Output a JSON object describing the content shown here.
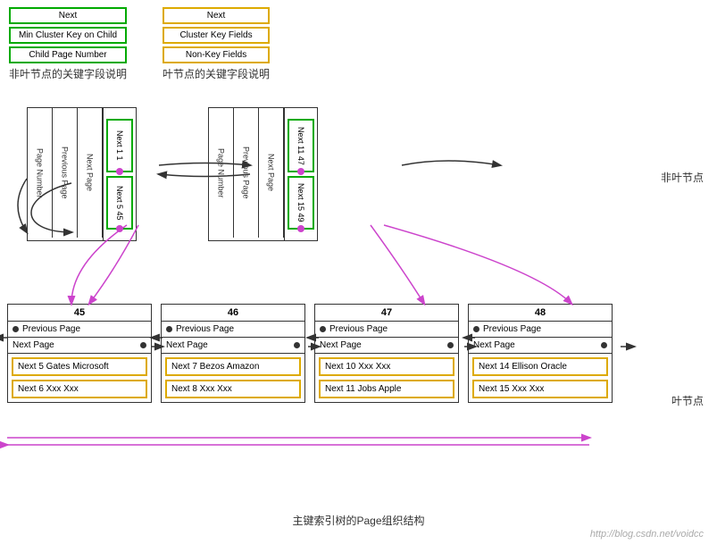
{
  "legend": {
    "nonleaf": {
      "title": "非叶节点的关键字段说明",
      "items": [
        "Next",
        "Min Cluster Key on Child",
        "Child Page Number"
      ],
      "border": "green"
    },
    "leaf": {
      "title": "叶节点的关键字段说明",
      "items": [
        "Next",
        "Cluster Key Fields",
        "Non-Key Fields"
      ],
      "border": "yellow"
    }
  },
  "nonleaf_label": "非叶节点",
  "leaf_label": "叶节点",
  "nonleaf_nodes": [
    {
      "cols": [
        "Page Number",
        "Previous Page",
        "Next Page",
        "Next 1 1",
        "Next 5 45"
      ]
    },
    {
      "cols": [
        "Page Number",
        "Previous Page",
        "Next Page",
        "Next 11 47",
        "Next 15 49"
      ]
    }
  ],
  "leaf_nodes": [
    {
      "number": "45",
      "prev": "Previous Page",
      "next": "Next Page",
      "rows": [
        "Next 5 Gates Microsoft",
        "Next 6 Xxx Xxx"
      ]
    },
    {
      "number": "46",
      "prev": "Previous Page",
      "next": "Next Page",
      "rows": [
        "Next 7 Bezos Amazon",
        "Next 8 Xxx Xxx"
      ]
    },
    {
      "number": "47",
      "prev": "Previous Page",
      "next": "Next Page",
      "rows": [
        "Next 10 Xxx Xxx",
        "Next 11 Jobs Apple"
      ]
    },
    {
      "number": "48",
      "prev": "Previous Page",
      "next": "Next Page",
      "rows": [
        "Next 14 Ellison Oracle",
        "Next 15 Xxx Xxx"
      ]
    }
  ],
  "bottom_label": "主键索引树的Page组织结构",
  "bottom_url": "http://blog.csdn.net/voidcc"
}
